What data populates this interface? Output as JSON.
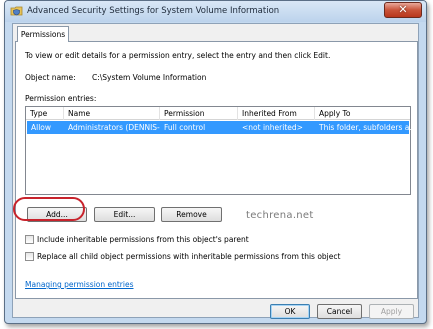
{
  "window": {
    "title": "Advanced Security Settings for System Volume Information",
    "close_symbol": "✕"
  },
  "tabs": [
    {
      "label": "Permissions"
    }
  ],
  "panel": {
    "instructions": "To view or edit details for a permission entry, select the entry and then click Edit.",
    "object_name_label": "Object name:",
    "object_name_value": "C:\\System Volume Information",
    "entries_label": "Permission entries:",
    "columns": [
      "Type",
      "Name",
      "Permission",
      "Inherited From",
      "Apply To"
    ],
    "rows": [
      {
        "type": "Allow",
        "name": "Administrators (DENNIS-...",
        "permission": "Full control",
        "inherited_from": "<not inherited>",
        "apply_to": "This folder, subfolders a..."
      }
    ],
    "buttons": {
      "add": "Add...",
      "edit": "Edit...",
      "remove": "Remove"
    },
    "watermark": "techrena.net",
    "checkboxes": [
      {
        "label": "Include inheritable permissions from this object's parent",
        "checked": false
      },
      {
        "label": "Replace all child object permissions with inheritable permissions from this object",
        "checked": false
      }
    ],
    "link": "Managing permission entries"
  },
  "footer": {
    "ok": "OK",
    "cancel": "Cancel",
    "apply": "Apply"
  },
  "colors": {
    "selection": "#3399ff",
    "highlight_ring": "#c8232c",
    "link": "#0066cc"
  },
  "icons": {
    "title": "shield-folder-icon"
  }
}
